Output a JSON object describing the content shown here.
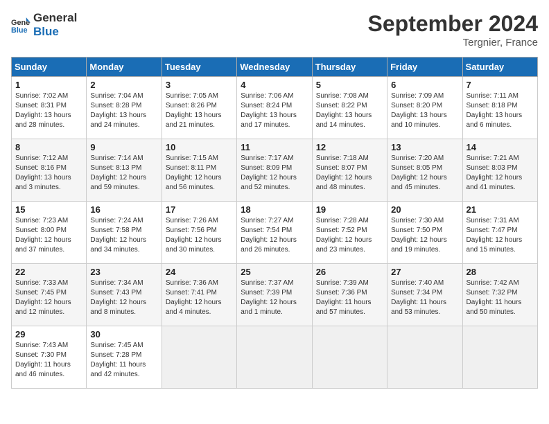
{
  "app": {
    "name_line1": "General",
    "name_line2": "Blue"
  },
  "calendar": {
    "month_year": "September 2024",
    "location": "Tergnier, France",
    "days_of_week": [
      "Sunday",
      "Monday",
      "Tuesday",
      "Wednesday",
      "Thursday",
      "Friday",
      "Saturday"
    ],
    "weeks": [
      [
        null,
        {
          "day": "2",
          "sunrise": "Sunrise: 7:04 AM",
          "sunset": "Sunset: 8:28 PM",
          "daylight": "Daylight: 13 hours and 24 minutes."
        },
        {
          "day": "3",
          "sunrise": "Sunrise: 7:05 AM",
          "sunset": "Sunset: 8:26 PM",
          "daylight": "Daylight: 13 hours and 21 minutes."
        },
        {
          "day": "4",
          "sunrise": "Sunrise: 7:06 AM",
          "sunset": "Sunset: 8:24 PM",
          "daylight": "Daylight: 13 hours and 17 minutes."
        },
        {
          "day": "5",
          "sunrise": "Sunrise: 7:08 AM",
          "sunset": "Sunset: 8:22 PM",
          "daylight": "Daylight: 13 hours and 14 minutes."
        },
        {
          "day": "6",
          "sunrise": "Sunrise: 7:09 AM",
          "sunset": "Sunset: 8:20 PM",
          "daylight": "Daylight: 13 hours and 10 minutes."
        },
        {
          "day": "7",
          "sunrise": "Sunrise: 7:11 AM",
          "sunset": "Sunset: 8:18 PM",
          "daylight": "Daylight: 13 hours and 6 minutes."
        }
      ],
      [
        {
          "day": "1",
          "sunrise": "Sunrise: 7:02 AM",
          "sunset": "Sunset: 8:31 PM",
          "daylight": "Daylight: 13 hours and 28 minutes."
        },
        {
          "day": "9",
          "sunrise": "Sunrise: 7:14 AM",
          "sunset": "Sunset: 8:13 PM",
          "daylight": "Daylight: 12 hours and 59 minutes."
        },
        {
          "day": "10",
          "sunrise": "Sunrise: 7:15 AM",
          "sunset": "Sunset: 8:11 PM",
          "daylight": "Daylight: 12 hours and 56 minutes."
        },
        {
          "day": "11",
          "sunrise": "Sunrise: 7:17 AM",
          "sunset": "Sunset: 8:09 PM",
          "daylight": "Daylight: 12 hours and 52 minutes."
        },
        {
          "day": "12",
          "sunrise": "Sunrise: 7:18 AM",
          "sunset": "Sunset: 8:07 PM",
          "daylight": "Daylight: 12 hours and 48 minutes."
        },
        {
          "day": "13",
          "sunrise": "Sunrise: 7:20 AM",
          "sunset": "Sunset: 8:05 PM",
          "daylight": "Daylight: 12 hours and 45 minutes."
        },
        {
          "day": "14",
          "sunrise": "Sunrise: 7:21 AM",
          "sunset": "Sunset: 8:03 PM",
          "daylight": "Daylight: 12 hours and 41 minutes."
        }
      ],
      [
        {
          "day": "8",
          "sunrise": "Sunrise: 7:12 AM",
          "sunset": "Sunset: 8:16 PM",
          "daylight": "Daylight: 13 hours and 3 minutes."
        },
        {
          "day": "16",
          "sunrise": "Sunrise: 7:24 AM",
          "sunset": "Sunset: 7:58 PM",
          "daylight": "Daylight: 12 hours and 34 minutes."
        },
        {
          "day": "17",
          "sunrise": "Sunrise: 7:26 AM",
          "sunset": "Sunset: 7:56 PM",
          "daylight": "Daylight: 12 hours and 30 minutes."
        },
        {
          "day": "18",
          "sunrise": "Sunrise: 7:27 AM",
          "sunset": "Sunset: 7:54 PM",
          "daylight": "Daylight: 12 hours and 26 minutes."
        },
        {
          "day": "19",
          "sunrise": "Sunrise: 7:28 AM",
          "sunset": "Sunset: 7:52 PM",
          "daylight": "Daylight: 12 hours and 23 minutes."
        },
        {
          "day": "20",
          "sunrise": "Sunrise: 7:30 AM",
          "sunset": "Sunset: 7:50 PM",
          "daylight": "Daylight: 12 hours and 19 minutes."
        },
        {
          "day": "21",
          "sunrise": "Sunrise: 7:31 AM",
          "sunset": "Sunset: 7:47 PM",
          "daylight": "Daylight: 12 hours and 15 minutes."
        }
      ],
      [
        {
          "day": "15",
          "sunrise": "Sunrise: 7:23 AM",
          "sunset": "Sunset: 8:00 PM",
          "daylight": "Daylight: 12 hours and 37 minutes."
        },
        {
          "day": "23",
          "sunrise": "Sunrise: 7:34 AM",
          "sunset": "Sunset: 7:43 PM",
          "daylight": "Daylight: 12 hours and 8 minutes."
        },
        {
          "day": "24",
          "sunrise": "Sunrise: 7:36 AM",
          "sunset": "Sunset: 7:41 PM",
          "daylight": "Daylight: 12 hours and 4 minutes."
        },
        {
          "day": "25",
          "sunrise": "Sunrise: 7:37 AM",
          "sunset": "Sunset: 7:39 PM",
          "daylight": "Daylight: 12 hours and 1 minute."
        },
        {
          "day": "26",
          "sunrise": "Sunrise: 7:39 AM",
          "sunset": "Sunset: 7:36 PM",
          "daylight": "Daylight: 11 hours and 57 minutes."
        },
        {
          "day": "27",
          "sunrise": "Sunrise: 7:40 AM",
          "sunset": "Sunset: 7:34 PM",
          "daylight": "Daylight: 11 hours and 53 minutes."
        },
        {
          "day": "28",
          "sunrise": "Sunrise: 7:42 AM",
          "sunset": "Sunset: 7:32 PM",
          "daylight": "Daylight: 11 hours and 50 minutes."
        }
      ],
      [
        {
          "day": "22",
          "sunrise": "Sunrise: 7:33 AM",
          "sunset": "Sunset: 7:45 PM",
          "daylight": "Daylight: 12 hours and 12 minutes."
        },
        {
          "day": "30",
          "sunrise": "Sunrise: 7:45 AM",
          "sunset": "Sunset: 7:28 PM",
          "daylight": "Daylight: 11 hours and 42 minutes."
        },
        null,
        null,
        null,
        null,
        null
      ],
      [
        {
          "day": "29",
          "sunrise": "Sunrise: 7:43 AM",
          "sunset": "Sunset: 7:30 PM",
          "daylight": "Daylight: 11 hours and 46 minutes."
        },
        null,
        null,
        null,
        null,
        null,
        null
      ]
    ]
  }
}
